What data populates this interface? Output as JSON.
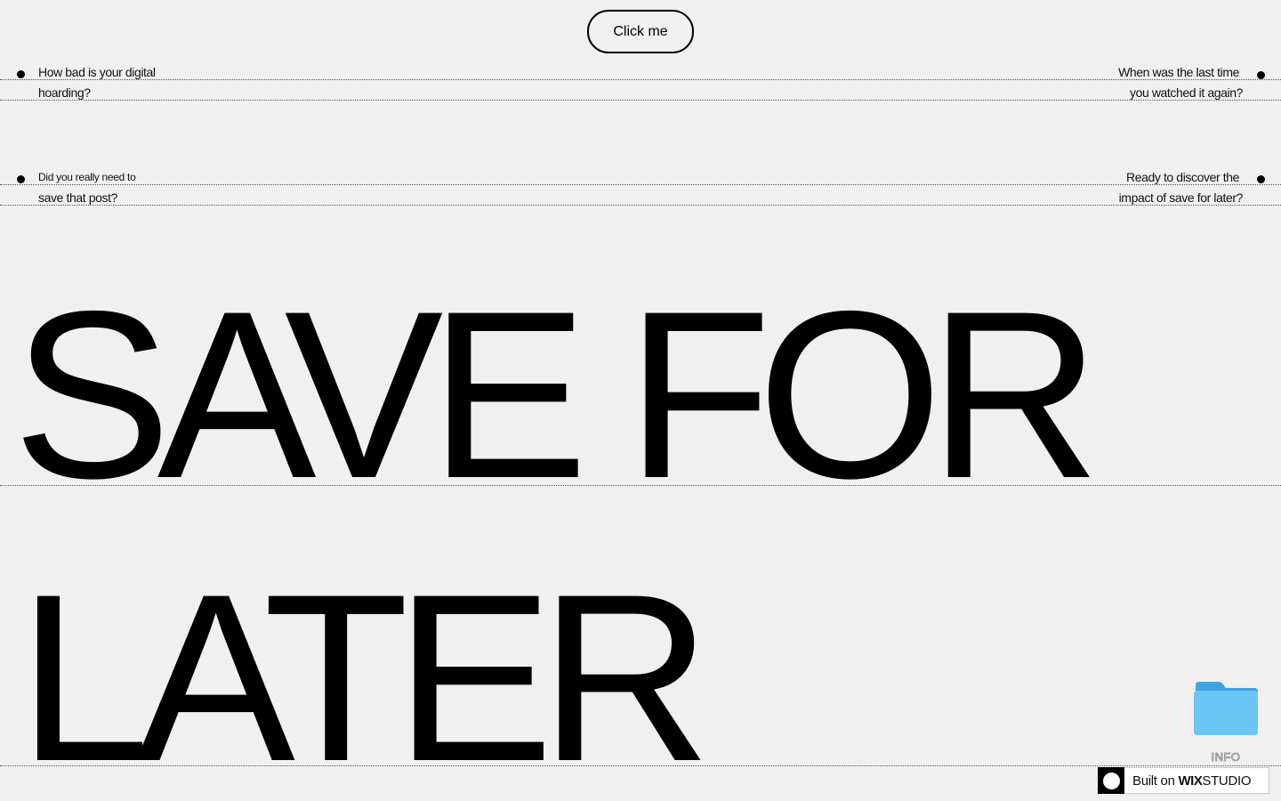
{
  "button": {
    "label": "Click me"
  },
  "questions": {
    "top_left": {
      "line1": "How bad is your digital",
      "line2": "hoarding?"
    },
    "top_right": {
      "line1": "When was the last time",
      "line2": "you watched it again?"
    },
    "mid_left": {
      "line1": "Did you really need to",
      "line2": "save that post?"
    },
    "mid_right": {
      "line1": "Ready to discover the",
      "line2": "impact of save for later?"
    }
  },
  "headline": {
    "line1": "SAVE FOR",
    "line2": "LATER"
  },
  "folder": {
    "label": "INFO",
    "icon": "folder-icon",
    "color": "#6cc6f5"
  },
  "wix_badge": {
    "prefix": "Built on",
    "brand": "WIX",
    "suffix": "STUDIO"
  },
  "colors": {
    "background": "#f0f0f0",
    "text": "#000000"
  }
}
